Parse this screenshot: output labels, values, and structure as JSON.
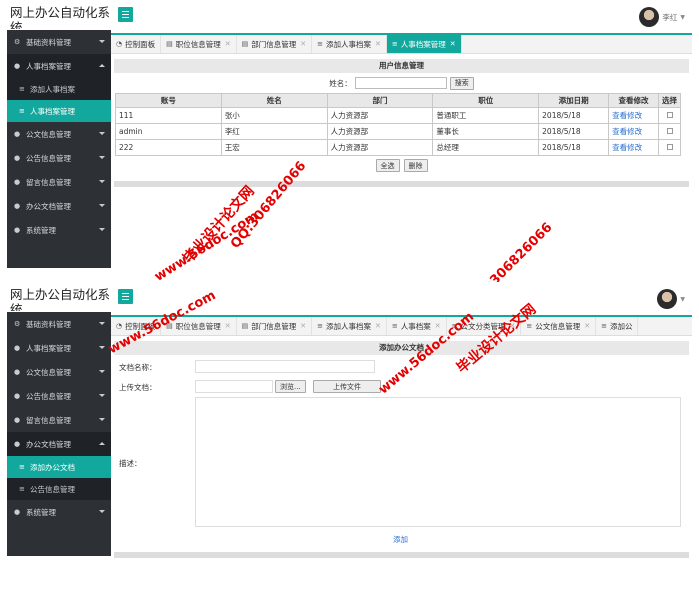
{
  "app_title": "网上办公自动化系统",
  "user_name": "李红",
  "watermark": {
    "site": "www.56doc.com",
    "qq": "QQ:306826066",
    "brand": "毕业设计论文网"
  },
  "screen1": {
    "sidebar": [
      {
        "label": "基础资料管理",
        "icon": "cogs-icon",
        "glyph": "⚙"
      },
      {
        "label": "人事档案管理",
        "icon": "circle-icon",
        "glyph": "●",
        "open": true
      },
      {
        "sub": true,
        "label": "添加人事档案",
        "glyph": "≡"
      },
      {
        "sub": true,
        "label": "人事档案管理",
        "glyph": "≡",
        "active": true
      },
      {
        "label": "公文信息管理",
        "icon": "circle-icon",
        "glyph": "●"
      },
      {
        "label": "公告信息管理",
        "icon": "circle-icon",
        "glyph": "●"
      },
      {
        "label": "留言信息管理",
        "icon": "circle-icon",
        "glyph": "●"
      },
      {
        "label": "办公文档管理",
        "icon": "circle-icon",
        "glyph": "●"
      },
      {
        "label": "系统管理",
        "icon": "circle-icon",
        "glyph": "●"
      }
    ],
    "tabs": [
      {
        "label": "控制面板",
        "glyph": "◔",
        "closable": false
      },
      {
        "label": "职位信息管理",
        "glyph": "▤",
        "closable": true
      },
      {
        "label": "部门信息管理",
        "glyph": "▤",
        "closable": true
      },
      {
        "label": "添加人事档案",
        "glyph": "≡",
        "closable": true
      },
      {
        "label": "人事档案管理",
        "glyph": "≡",
        "closable": true,
        "active": true
      }
    ],
    "panel_title": "用户信息管理",
    "search_label": "姓名：",
    "search_button": "搜索",
    "columns": [
      "账号",
      "姓名",
      "部门",
      "职位",
      "添加日期",
      "查看修改",
      "选择"
    ],
    "rows": [
      {
        "account": "111",
        "name": "张小",
        "dept": "人力资源部",
        "position": "普通职工",
        "date": "2018/5/18",
        "action": "查看修改"
      },
      {
        "account": "admin",
        "name": "李红",
        "dept": "人力资源部",
        "position": "董事长",
        "date": "2018/5/18",
        "action": "查看修改"
      },
      {
        "account": "222",
        "name": "王宏",
        "dept": "人力资源部",
        "position": "总经理",
        "date": "2018/5/18",
        "action": "查看修改"
      }
    ],
    "select_all": "全选",
    "delete": "删除"
  },
  "screen2": {
    "sidebar": [
      {
        "label": "基础资料管理",
        "icon": "cogs-icon",
        "glyph": "⚙"
      },
      {
        "label": "人事档案管理",
        "icon": "circle-icon",
        "glyph": "●"
      },
      {
        "label": "公文信息管理",
        "icon": "circle-icon",
        "glyph": "●"
      },
      {
        "label": "公告信息管理",
        "icon": "circle-icon",
        "glyph": "●"
      },
      {
        "label": "留言信息管理",
        "icon": "circle-icon",
        "glyph": "●"
      },
      {
        "label": "办公文档管理",
        "icon": "circle-icon",
        "glyph": "●",
        "open": true
      },
      {
        "sub": true,
        "label": "添加办公文档",
        "glyph": "≡",
        "active": true
      },
      {
        "sub": true,
        "label": "公告信息管理",
        "glyph": "≡"
      },
      {
        "label": "系统管理",
        "icon": "circle-icon",
        "glyph": "●"
      }
    ],
    "tabs": [
      {
        "label": "控制面板",
        "glyph": "◔",
        "closable": false
      },
      {
        "label": "职位信息管理",
        "glyph": "▤",
        "closable": true
      },
      {
        "label": "部门信息管理",
        "glyph": "▤",
        "closable": true
      },
      {
        "label": "添加人事档案",
        "glyph": "≡",
        "closable": true
      },
      {
        "label": "人事档案",
        "glyph": "≡",
        "closable": true
      },
      {
        "label": "公文分类管理",
        "glyph": "≡",
        "closable": true
      },
      {
        "label": "公文信息管理",
        "glyph": "≡",
        "closable": true
      },
      {
        "label": "添加公",
        "glyph": "≡",
        "closable": false
      }
    ],
    "panel_title": "添加办公文档",
    "doc_name_label": "文档名称：",
    "upload_label": "上传文档：",
    "browse_button": "浏览...",
    "upload_button": "上传文件",
    "desc_label": "描述：",
    "submit": "添加"
  }
}
